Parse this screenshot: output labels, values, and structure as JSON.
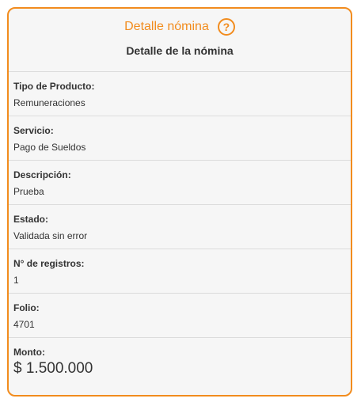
{
  "card": {
    "title": "Detalle nómina",
    "help_glyph": "?",
    "subtitle": "Detalle de la nómina"
  },
  "fields": [
    {
      "label": "Tipo de Producto:",
      "value": "Remuneraciones"
    },
    {
      "label": "Servicio:",
      "value": "Pago de Sueldos"
    },
    {
      "label": "Descripción:",
      "value": "Prueba"
    },
    {
      "label": "Estado:",
      "value": "Validada sin error"
    },
    {
      "label": "N° de registros:",
      "value": "1"
    },
    {
      "label": "Folio:",
      "value": "4701"
    },
    {
      "label": "Monto:",
      "value": "$ 1.500.000"
    }
  ],
  "colors": {
    "accent": "#f28c1e",
    "background": "#f6f6f6",
    "divider": "#dcdcdc",
    "text": "#333333"
  },
  "icons": {
    "help": "help-circle-icon"
  }
}
